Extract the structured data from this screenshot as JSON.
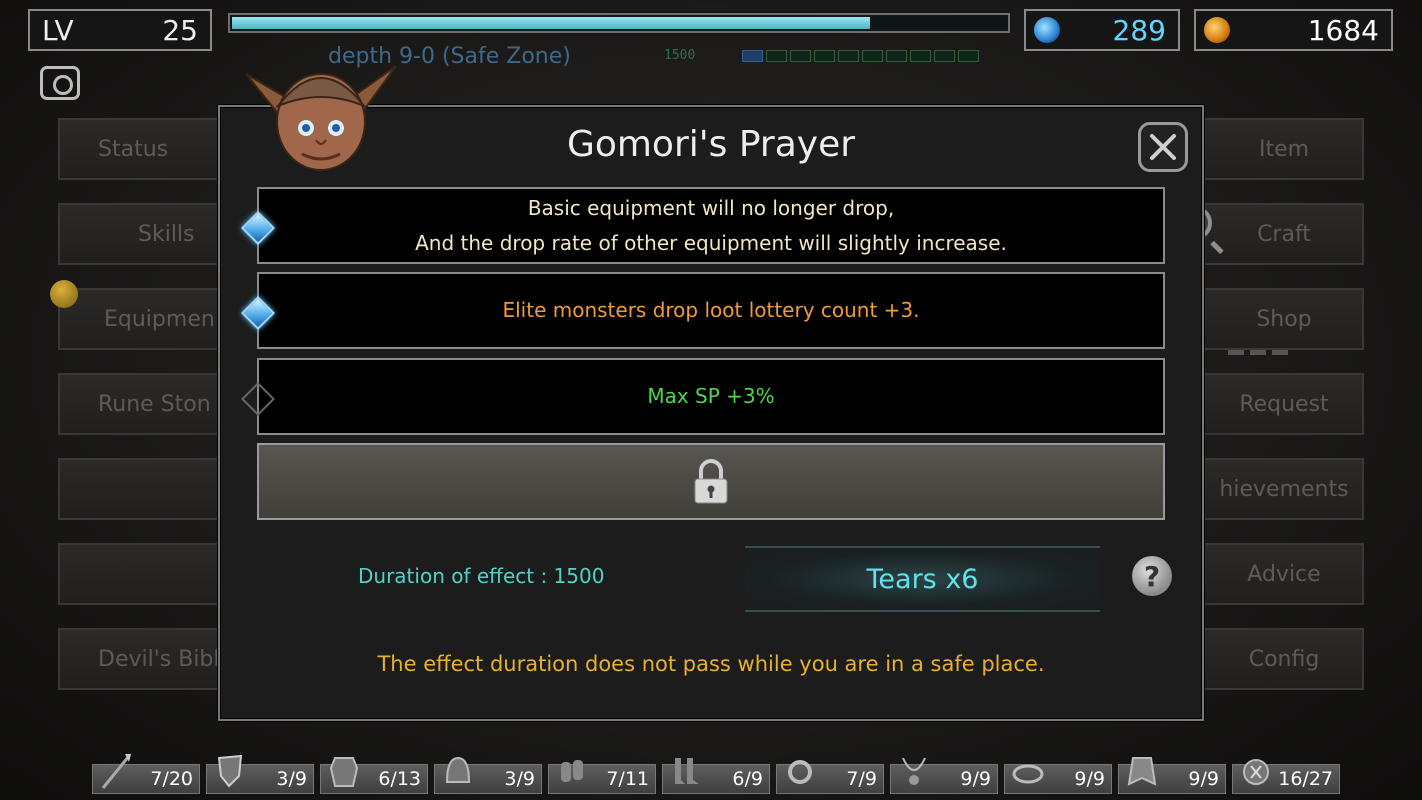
{
  "hud": {
    "level_label": "LV",
    "level_value": "25",
    "xp_fill_fraction": 0.82,
    "gems": "289",
    "gold": "1684",
    "depth_label": "depth 9-0 (Safe Zone)",
    "depth_counter": "1500",
    "colors": {
      "gems": "#5fd8ff",
      "gold": "#ffffff",
      "xp": "#7fd6e3"
    }
  },
  "left_menu": [
    "Status",
    "Skills",
    "Equipmen",
    "Rune Ston",
    "",
    "",
    "Devil's Bibl"
  ],
  "right_menu": [
    "Item",
    "Craft",
    "Shop",
    "Request",
    "hievements",
    "Advice",
    "Config"
  ],
  "dialog": {
    "title": "Gomori's Prayer",
    "options": [
      {
        "lines": [
          "Basic equipment will no longer drop,",
          "And the drop rate of other equipment will slightly increase."
        ],
        "color": "#f1e7c4",
        "active": true
      },
      {
        "lines": [
          "Elite monsters drop loot lottery count +3."
        ],
        "color": "#f09a3a",
        "active": true
      },
      {
        "lines": [
          "Max SP +3%"
        ],
        "color": "#4fd64a",
        "active": false
      }
    ],
    "duration_text": "Duration of effect : 1500",
    "tears_button": "Tears x6",
    "help_symbol": "?",
    "notice": "The effect duration does not pass while you are in a safe place."
  },
  "bottom_slots": [
    {
      "icon": "spear-icon",
      "count": "7/20"
    },
    {
      "icon": "shield-icon",
      "count": "3/9"
    },
    {
      "icon": "armor-icon",
      "count": "6/13"
    },
    {
      "icon": "helmet-icon",
      "count": "3/9"
    },
    {
      "icon": "gloves-icon",
      "count": "7/11"
    },
    {
      "icon": "boots-icon",
      "count": "6/9"
    },
    {
      "icon": "ring-icon",
      "count": "7/9"
    },
    {
      "icon": "necklace-icon",
      "count": "9/9"
    },
    {
      "icon": "belt-icon",
      "count": "9/9"
    },
    {
      "icon": "cloak-icon",
      "count": "9/9"
    },
    {
      "icon": "rune-icon",
      "count": "16/27"
    }
  ]
}
